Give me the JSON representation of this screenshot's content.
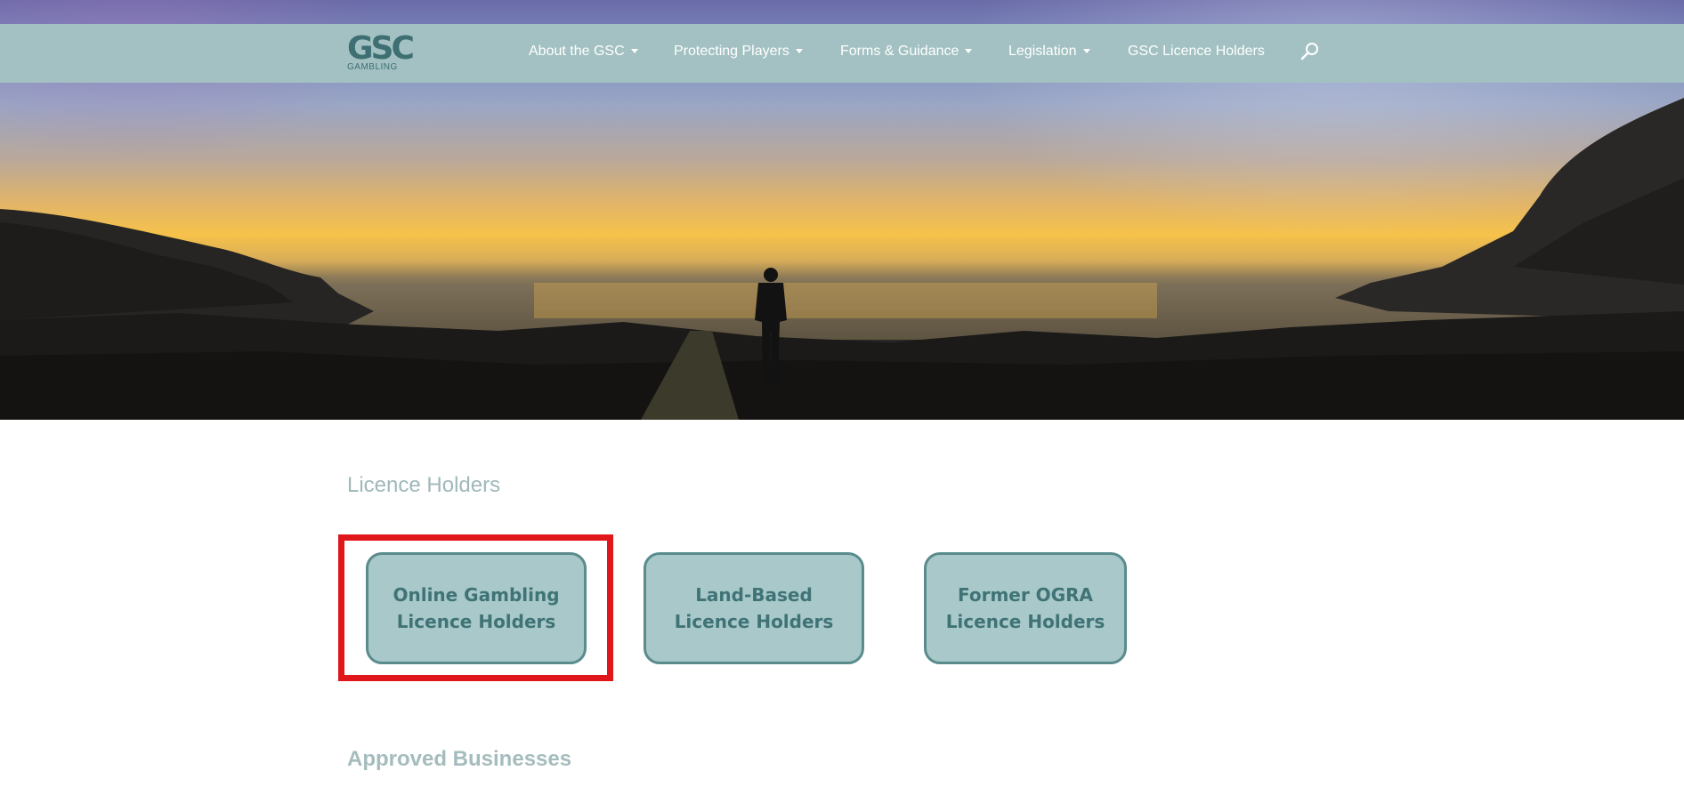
{
  "navbar": {
    "logo": {
      "main": "GSC",
      "sub": "GAMBLING"
    },
    "items": [
      {
        "label": "About the GSC",
        "has_dropdown": true
      },
      {
        "label": "Protecting Players",
        "has_dropdown": true
      },
      {
        "label": "Forms & Guidance",
        "has_dropdown": true
      },
      {
        "label": "Legislation",
        "has_dropdown": true
      },
      {
        "label": "GSC Licence Holders",
        "has_dropdown": false
      }
    ],
    "search_icon": "search-icon"
  },
  "content": {
    "licence_title": "Licence Holders",
    "tiles": [
      {
        "line1": "Online Gambling",
        "line2": "Licence Holders",
        "highlighted": true
      },
      {
        "line1": "Land-Based",
        "line2": "Licence Holders",
        "highlighted": false
      },
      {
        "line1": "Former OGRA",
        "line2": "Licence Holders",
        "highlighted": false
      }
    ],
    "approved_title": "Approved Businesses"
  },
  "colors": {
    "nav_bg": "#a3c1c2",
    "tile_bg": "#a8c8c9",
    "tile_border": "#5a8b8d",
    "tile_text": "#3f7376",
    "highlight": "#e0161b"
  }
}
